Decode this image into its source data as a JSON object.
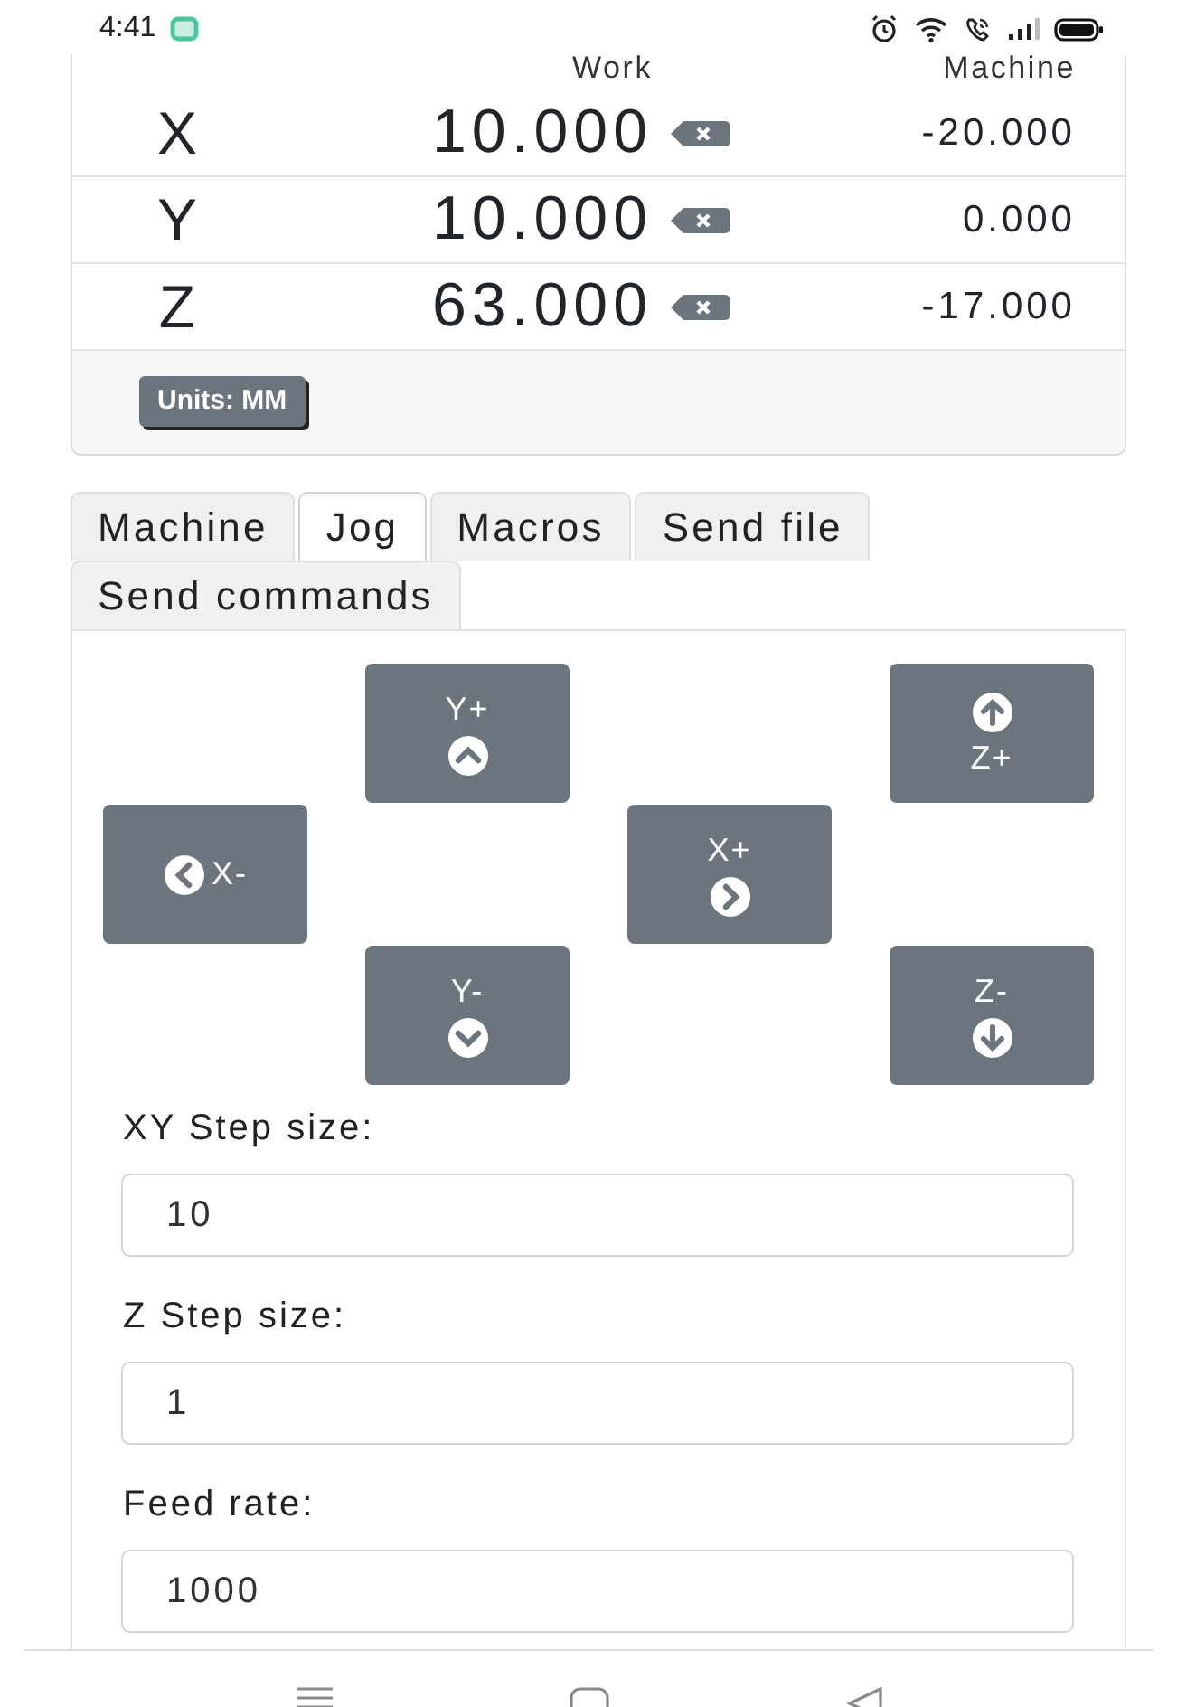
{
  "status_bar": {
    "time": "4:41"
  },
  "coordinates": {
    "columns": [
      "Work",
      "Machine"
    ],
    "rows": [
      {
        "axis": "X",
        "work": "10.000",
        "machine": "-20.000"
      },
      {
        "axis": "Y",
        "work": "10.000",
        "machine": "0.000"
      },
      {
        "axis": "Z",
        "work": "63.000",
        "machine": "-17.000"
      }
    ],
    "units_button": "Units: MM"
  },
  "tabs": [
    {
      "label": "Machine",
      "selected": false
    },
    {
      "label": "Jog",
      "selected": true
    },
    {
      "label": "Macros",
      "selected": false
    },
    {
      "label": "Send file",
      "selected": false
    },
    {
      "label": "Send commands",
      "selected": false
    }
  ],
  "jog_buttons": [
    {
      "kind": "y_plus",
      "label": "Y+"
    },
    {
      "kind": "z_plus",
      "label": "Z+"
    },
    {
      "kind": "x_minus",
      "label": "X-"
    },
    {
      "kind": "x_plus",
      "label": "X+"
    },
    {
      "kind": "y_minus",
      "label": "Y-"
    },
    {
      "kind": "z_minus",
      "label": "Z-"
    }
  ],
  "fields": [
    {
      "label": "XY Step size:",
      "value": "10"
    },
    {
      "label": "Z Step size:",
      "value": "1"
    },
    {
      "label": "Feed rate:",
      "value": "1000"
    }
  ]
}
